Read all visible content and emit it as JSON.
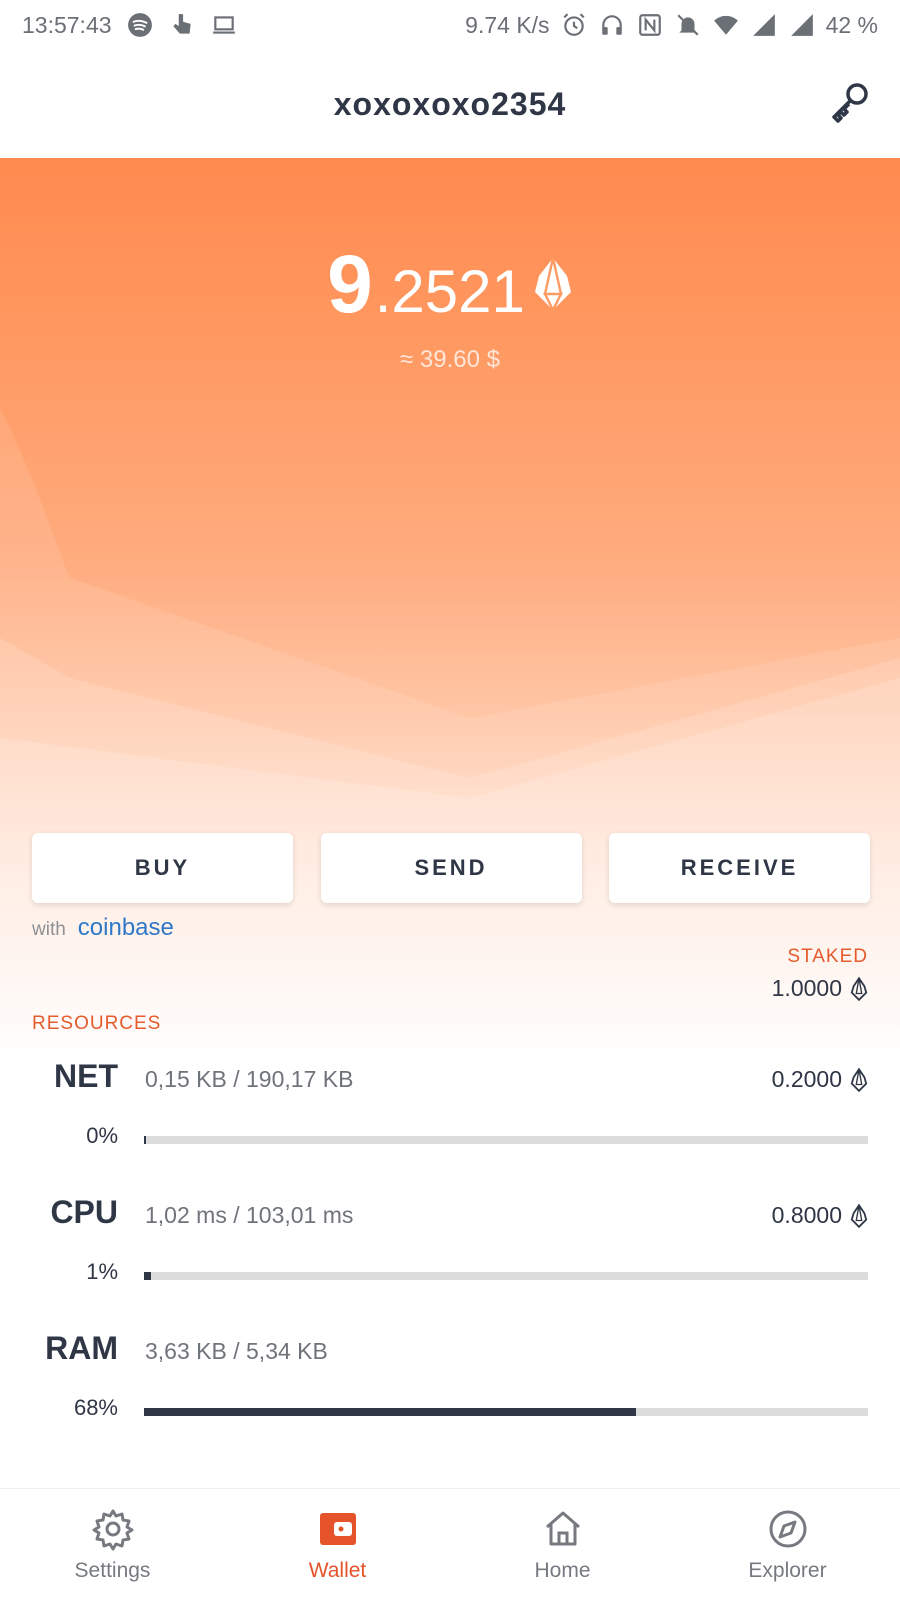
{
  "status_bar": {
    "time": "13:57:43",
    "speed": "9.74 K/s",
    "battery": "42 %",
    "left_icons": [
      "spotify-icon",
      "touch-icon",
      "laptop-icon"
    ],
    "right_icons": [
      "alarm-icon",
      "headphones-icon",
      "nfc-icon",
      "bell-off-icon",
      "wifi-icon",
      "signal-icon",
      "signal-icon"
    ]
  },
  "header": {
    "account_name": "xoxoxoxo2354",
    "key_icon": "key-icon"
  },
  "balance": {
    "integer": "9",
    "decimal": ".2521",
    "fiat": "≈ 39.60 $",
    "currency_icon": "eos-icon"
  },
  "actions": {
    "buy": "BUY",
    "send": "SEND",
    "receive": "RECEIVE"
  },
  "coinbase": {
    "with": "with",
    "brand": "coinbase"
  },
  "staked": {
    "label": "STAKED",
    "value": "1.0000"
  },
  "resources": {
    "label": "RESOURCES",
    "items": [
      {
        "name": "NET",
        "usage": "0,15 KB / 190,17 KB",
        "staked": "0.2000",
        "percent_text": "0%",
        "fill_fraction": 0.003
      },
      {
        "name": "CPU",
        "usage": "1,02 ms / 103,01 ms",
        "staked": "0.8000",
        "percent_text": "1%",
        "fill_fraction": 0.01
      },
      {
        "name": "RAM",
        "usage": "3,63 KB / 5,34 KB",
        "staked": "",
        "percent_text": "68%",
        "fill_fraction": 0.68
      }
    ]
  },
  "nav": {
    "items": [
      {
        "label": "Settings",
        "icon": "gear-icon",
        "active": false
      },
      {
        "label": "Wallet",
        "icon": "wallet-icon",
        "active": true
      },
      {
        "label": "Home",
        "icon": "home-icon",
        "active": false
      },
      {
        "label": "Explorer",
        "icon": "compass-icon",
        "active": false
      }
    ]
  },
  "colors": {
    "accent": "#e5532a",
    "hero_top": "#ff8a4f",
    "text_dark": "#2f3646",
    "bar_track": "#dcdcdc",
    "coinbase_blue": "#2f78c8"
  }
}
